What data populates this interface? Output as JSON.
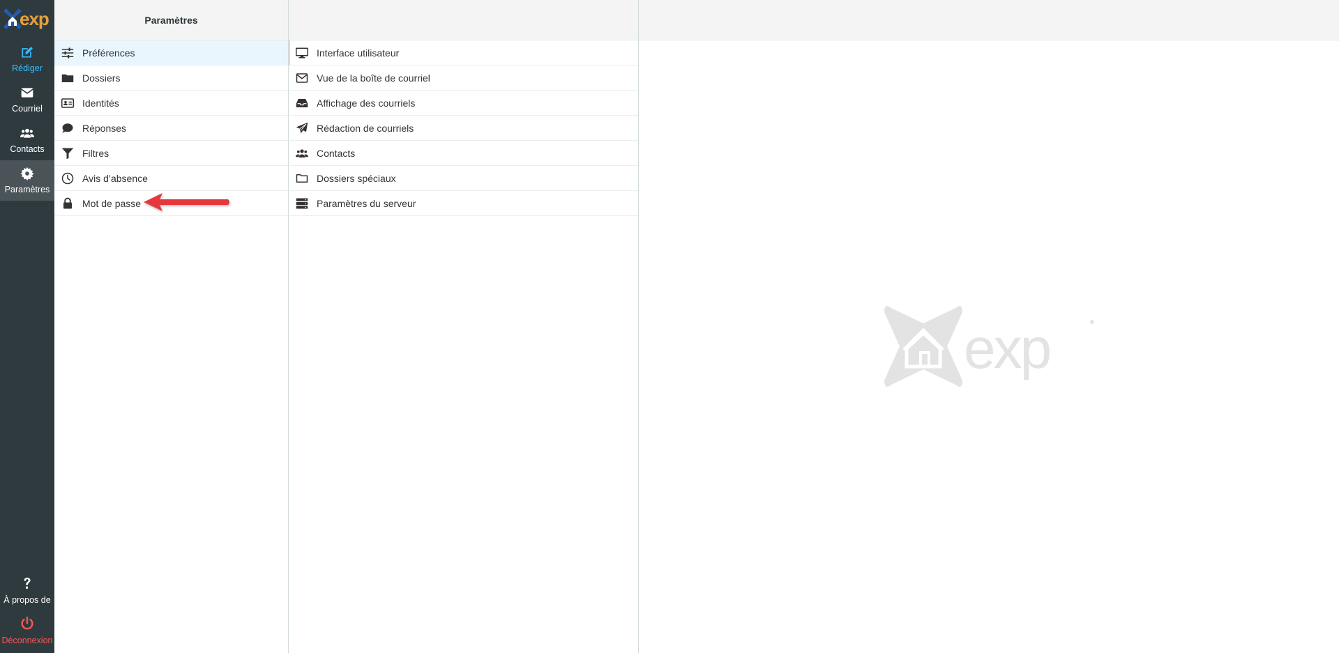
{
  "app": {
    "logo_text": "exp",
    "colors": {
      "rail_bg": "#2f3a3f",
      "rail_active": "#4a5357",
      "accent_blue": "#37beff",
      "logout_red": "#ff5552",
      "selected_row": "#e9f6fd",
      "arrow_red": "#e4393c"
    }
  },
  "rail": {
    "compose": {
      "label": "Rédiger",
      "icon": "edit-icon"
    },
    "mail": {
      "label": "Courriel",
      "icon": "envelope-icon"
    },
    "contacts": {
      "label": "Contacts",
      "icon": "users-icon"
    },
    "settings": {
      "label": "Paramètres",
      "icon": "gear-icon"
    },
    "about": {
      "label": "À propos de",
      "icon": "question-icon"
    },
    "logout": {
      "label": "Déconnexion",
      "icon": "power-icon"
    }
  },
  "settings_column": {
    "title": "Paramètres",
    "items": [
      {
        "label": "Préférences",
        "icon": "sliders-icon",
        "selected": true
      },
      {
        "label": "Dossiers",
        "icon": "folder-icon",
        "selected": false
      },
      {
        "label": "Identités",
        "icon": "id-card-icon",
        "selected": false
      },
      {
        "label": "Réponses",
        "icon": "comment-icon",
        "selected": false
      },
      {
        "label": "Filtres",
        "icon": "filter-icon",
        "selected": false
      },
      {
        "label": "Avis d’absence",
        "icon": "clock-icon",
        "selected": false
      },
      {
        "label": "Mot de passe",
        "icon": "lock-icon",
        "selected": false
      }
    ]
  },
  "sections_column": {
    "title": "",
    "items": [
      {
        "label": "Interface utilisateur",
        "icon": "desktop-icon"
      },
      {
        "label": "Vue de la boîte de courriel",
        "icon": "envelope-outline-icon"
      },
      {
        "label": "Affichage des courriels",
        "icon": "inbox-icon"
      },
      {
        "label": "Rédaction de courriels",
        "icon": "paper-plane-icon"
      },
      {
        "label": "Contacts",
        "icon": "users-icon"
      },
      {
        "label": "Dossiers spéciaux",
        "icon": "folder-outline-icon"
      },
      {
        "label": "Paramètres du serveur",
        "icon": "server-icon"
      }
    ]
  },
  "content": {
    "watermark_text": "exp"
  }
}
